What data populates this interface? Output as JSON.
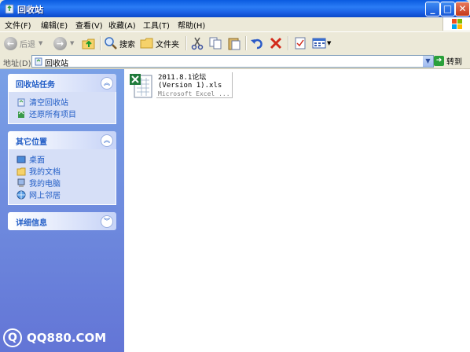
{
  "window": {
    "title": "回收站"
  },
  "menu": [
    "文件(F)",
    "编辑(E)",
    "查看(V)",
    "收藏(A)",
    "工具(T)",
    "帮助(H)"
  ],
  "toolbar": {
    "back": "后退",
    "search": "搜索",
    "folders": "文件夹"
  },
  "address": {
    "label": "地址(D)",
    "value": "回收站",
    "go": "转到"
  },
  "panels": [
    {
      "title": "回收站任务",
      "items": [
        "清空回收站",
        "还原所有项目"
      ]
    },
    {
      "title": "其它位置",
      "items": [
        "桌面",
        "我的文档",
        "我的电脑",
        "网上邻居"
      ]
    },
    {
      "title": "详细信息",
      "items": []
    }
  ],
  "file": {
    "name_line1": "2011.8.1论坛",
    "name_line2": "(Version 1).xls",
    "type": "Microsoft Excel ..."
  },
  "watermark": {
    "symbol": "Q",
    "text": "QQ880.COM"
  },
  "colors": {
    "title_bar": "#1c63e6",
    "left_pane": "#6375d6",
    "panel_text": "#215dc6"
  }
}
